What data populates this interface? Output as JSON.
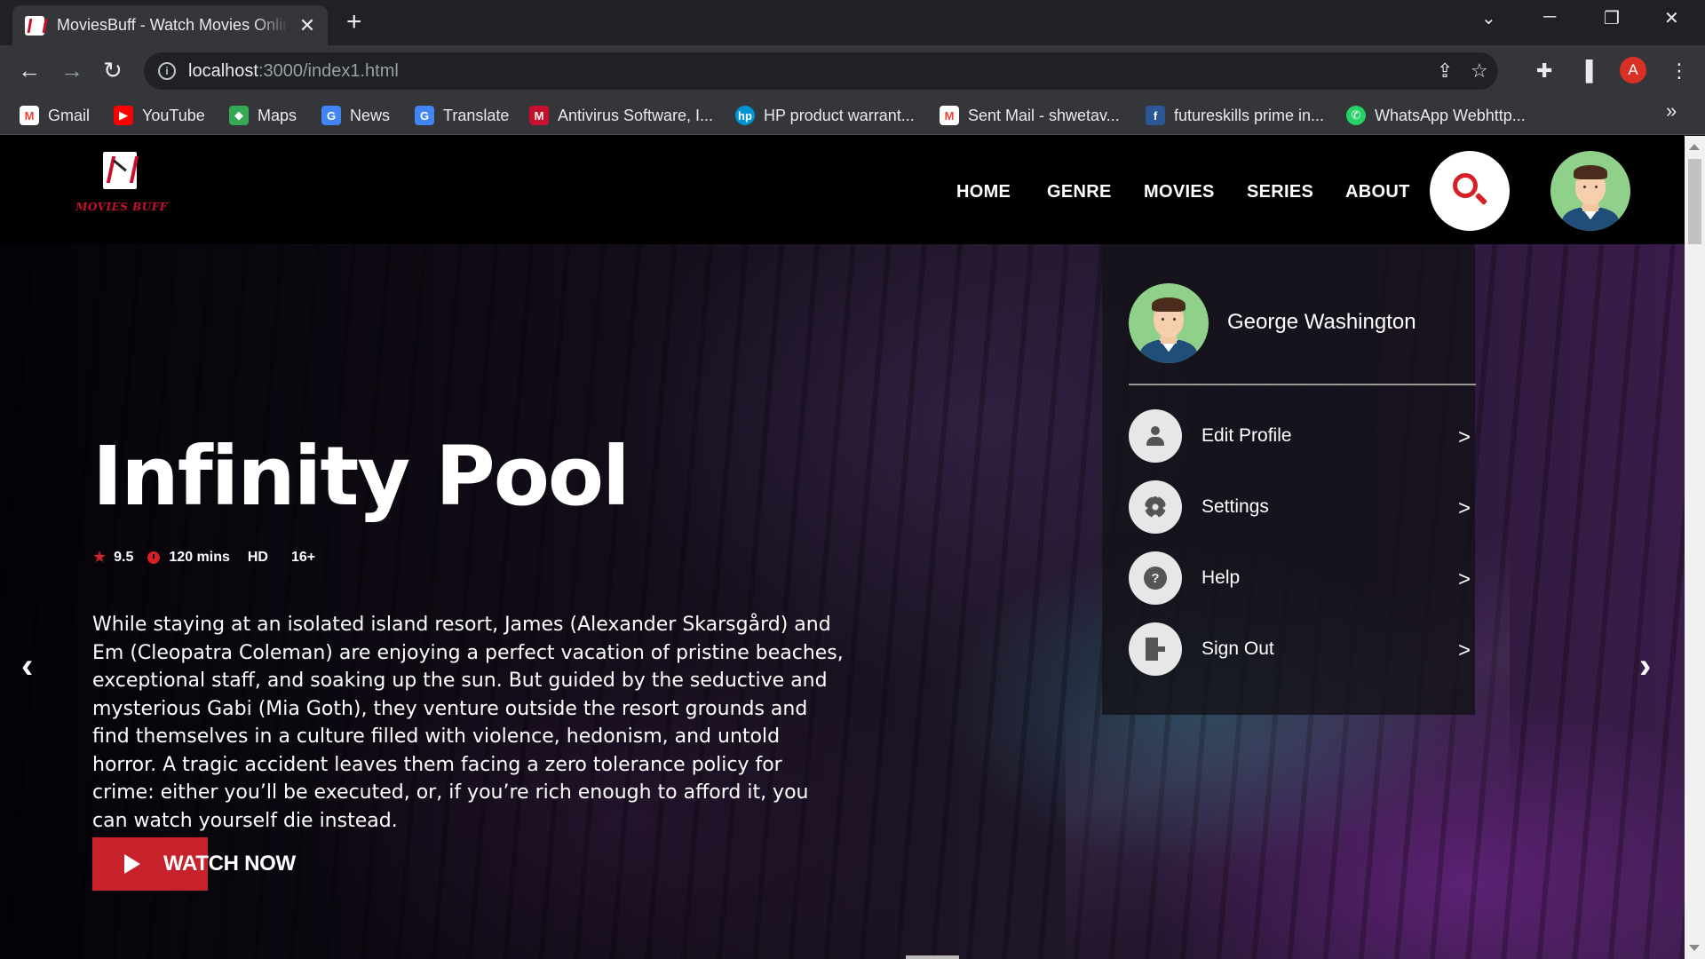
{
  "browser": {
    "tab_title": "MoviesBuff - Watch Movies Online",
    "url_host": "localhost",
    "url_path": ":3000/index1.html",
    "profile_initial": "A",
    "bookmarks": [
      {
        "label": "Gmail",
        "icon": "gmail-icon",
        "color": "#ea4335"
      },
      {
        "label": "YouTube",
        "icon": "youtube-icon",
        "color": "#ff0000"
      },
      {
        "label": "Maps",
        "icon": "maps-icon",
        "color": "#34a853"
      },
      {
        "label": "News",
        "icon": "news-icon",
        "color": "#4285f4"
      },
      {
        "label": "Translate",
        "icon": "translate-icon",
        "color": "#4285f4"
      },
      {
        "label": "Antivirus Software, I...",
        "icon": "mcafee-icon",
        "color": "#c8102e"
      },
      {
        "label": "HP product warrant...",
        "icon": "hp-icon",
        "color": "#0096d6"
      },
      {
        "label": "Sent Mail - shwetav...",
        "icon": "gmail-icon",
        "color": "#ea4335"
      },
      {
        "label": "futureskills prime in...",
        "icon": "futureskills-icon",
        "color": "#2b5797"
      },
      {
        "label": "WhatsApp Webhttp...",
        "icon": "whatsapp-icon",
        "color": "#25d366"
      }
    ]
  },
  "site": {
    "logo_text": "MOVIES BUFF",
    "nav": [
      "HOME",
      "GENRE",
      "MOVIES",
      "SERIES",
      "ABOUT"
    ],
    "accent": "#d71f26"
  },
  "hero": {
    "title": "Infinity Pool",
    "rating": "9.5",
    "duration": "120 mins",
    "quality": "HD",
    "age": "16+",
    "description": "While staying at an isolated island resort, James (Alexander Skarsgård) and Em (Cleopatra Coleman) are enjoying a perfect vacation of pristine beaches, exceptional staff, and soaking up the sun. But guided by the seductive and mysterious Gabi (Mia Goth), they venture outside the resort grounds and find themselves in a culture filled with violence, hedonism, and untold horror. A tragic accident leaves them facing a zero tolerance policy for crime: either you’ll be executed, or, if you’re rich enough to afford it, you can watch yourself die instead.",
    "cta_label": "WATCH NOW"
  },
  "profile_menu": {
    "user_name": "George Washington",
    "items": [
      {
        "label": "Edit Profile",
        "icon": "user-icon",
        "chevron": ">"
      },
      {
        "label": "Settings",
        "icon": "gear-icon",
        "chevron": ">"
      },
      {
        "label": "Help",
        "icon": "help-icon",
        "chevron": ">"
      },
      {
        "label": "Sign Out",
        "icon": "sign-out-icon",
        "chevron": ">"
      }
    ]
  }
}
